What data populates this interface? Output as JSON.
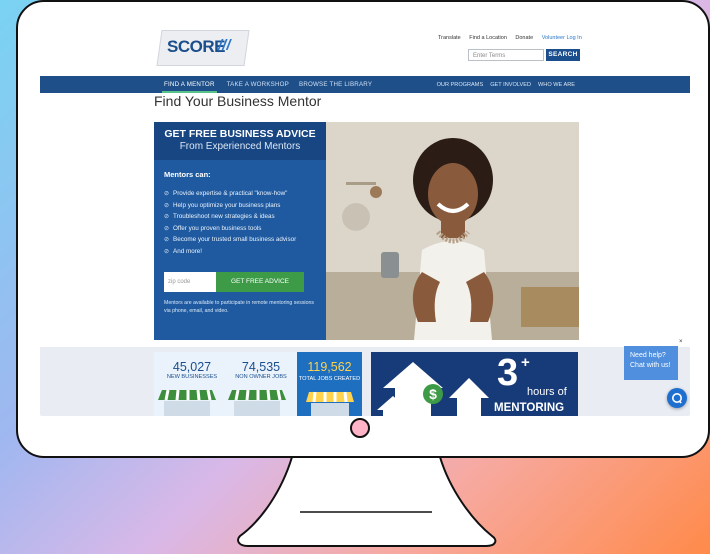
{
  "site": {
    "logo": "SCORE",
    "util_links": [
      "Translate",
      "Find a Location",
      "Donate"
    ],
    "login_link": "Volunteer Log In",
    "search_placeholder": "Enter Terms",
    "search_button": "SEARCH"
  },
  "nav": {
    "left": [
      "FIND A MENTOR",
      "TAKE A WORKSHOP",
      "BROWSE THE LIBRARY"
    ],
    "right": [
      "OUR PROGRAMS",
      "GET INVOLVED",
      "WHO WE ARE"
    ]
  },
  "page_title": "Find Your Business Mentor",
  "hero": {
    "heading": "GET FREE BUSINESS ADVICE",
    "subheading": "From Experienced Mentors",
    "mentors_can": "Mentors can:",
    "benefits": [
      "Provide expertise & practical \"know-how\"",
      "Help you optimize your business plans",
      "Troubleshoot new strategies & ideas",
      "Offer you proven business tools",
      "Become your trusted small business advisor",
      "And more!"
    ],
    "zip_placeholder": "zip code",
    "cta": "GET FREE ADVICE",
    "remote_note": "Mentors are available to participate in remote mentoring sessions via phone, email, and video."
  },
  "stats": {
    "new_businesses_num": "45,027",
    "new_businesses_label": "NEW BUSINESSES",
    "non_owner_num": "74,535",
    "non_owner_label": "NON OWNER JOBS",
    "total_jobs_num": "119,562",
    "total_jobs_label": "TOTAL JOBS CREATED"
  },
  "mentoring": {
    "number": "3",
    "plus": "+",
    "hours": "hours of",
    "label": "MENTORING"
  },
  "chat": {
    "line1": "Need help?",
    "line2": "Chat with us!",
    "close": "×"
  },
  "colors": {
    "brand_blue": "#1e4f88",
    "cta_green": "#3d9b47",
    "accent_yellow": "#ffd34e",
    "power_button": "#ffb3c7"
  }
}
